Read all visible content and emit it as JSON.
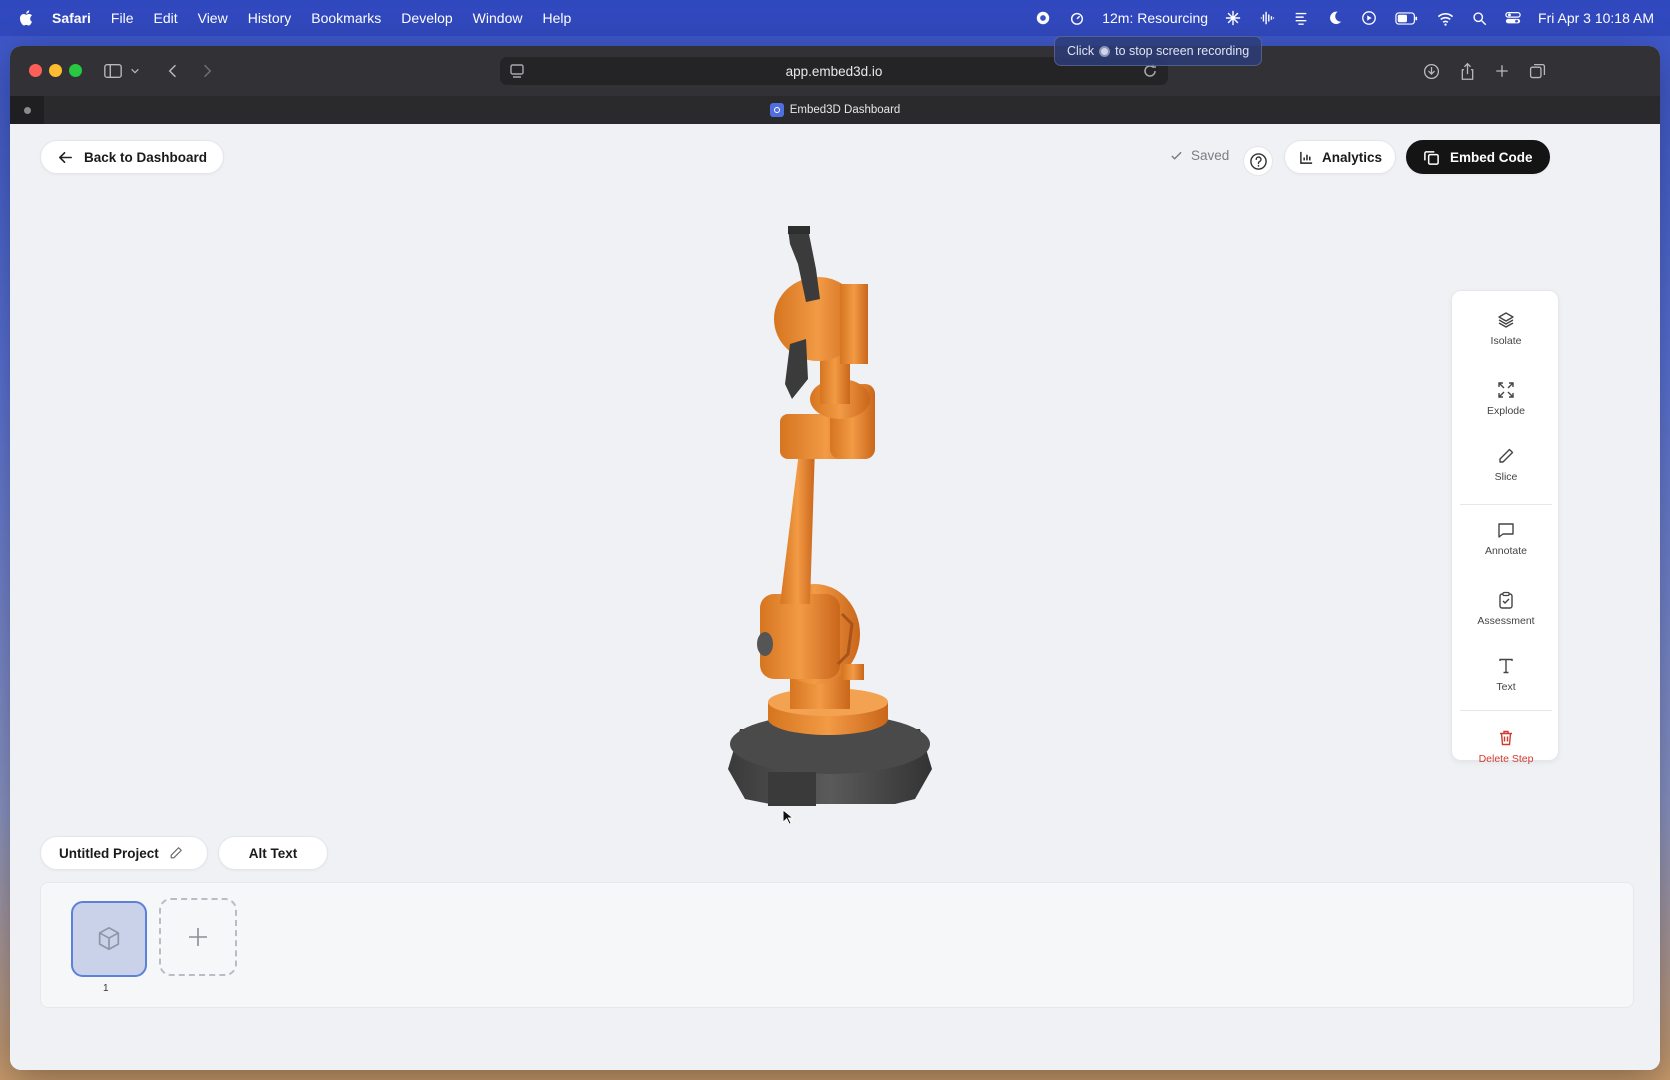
{
  "menubar": {
    "app": "Safari",
    "items": [
      "File",
      "Edit",
      "View",
      "History",
      "Bookmarks",
      "Develop",
      "Window",
      "Help"
    ],
    "timer": "12m: Resourcing",
    "datetime": "Fri Apr 3  10:18 AM"
  },
  "recording_tooltip": {
    "before": "Click",
    "after": "to stop screen recording"
  },
  "browser": {
    "url": "app.embed3d.io",
    "tab_title": "Embed3D Dashboard"
  },
  "header": {
    "back_label": "Back to Dashboard",
    "saved_label": "Saved",
    "analytics_label": "Analytics",
    "embed_label": "Embed Code"
  },
  "tools": {
    "isolate": "Isolate",
    "explode": "Explode",
    "slice": "Slice",
    "annotate": "Annotate",
    "assessment": "Assessment",
    "text": "Text",
    "delete": "Delete Step"
  },
  "project": {
    "name": "Untitled Project",
    "alt_text_label": "Alt Text"
  },
  "steps": {
    "items": [
      {
        "number": "1"
      }
    ]
  },
  "colors": {
    "robot_orange": "#e8892f",
    "robot_base": "#4a4a4a",
    "accent_blue": "#5d80d8",
    "delete_red": "#d23a2e"
  }
}
